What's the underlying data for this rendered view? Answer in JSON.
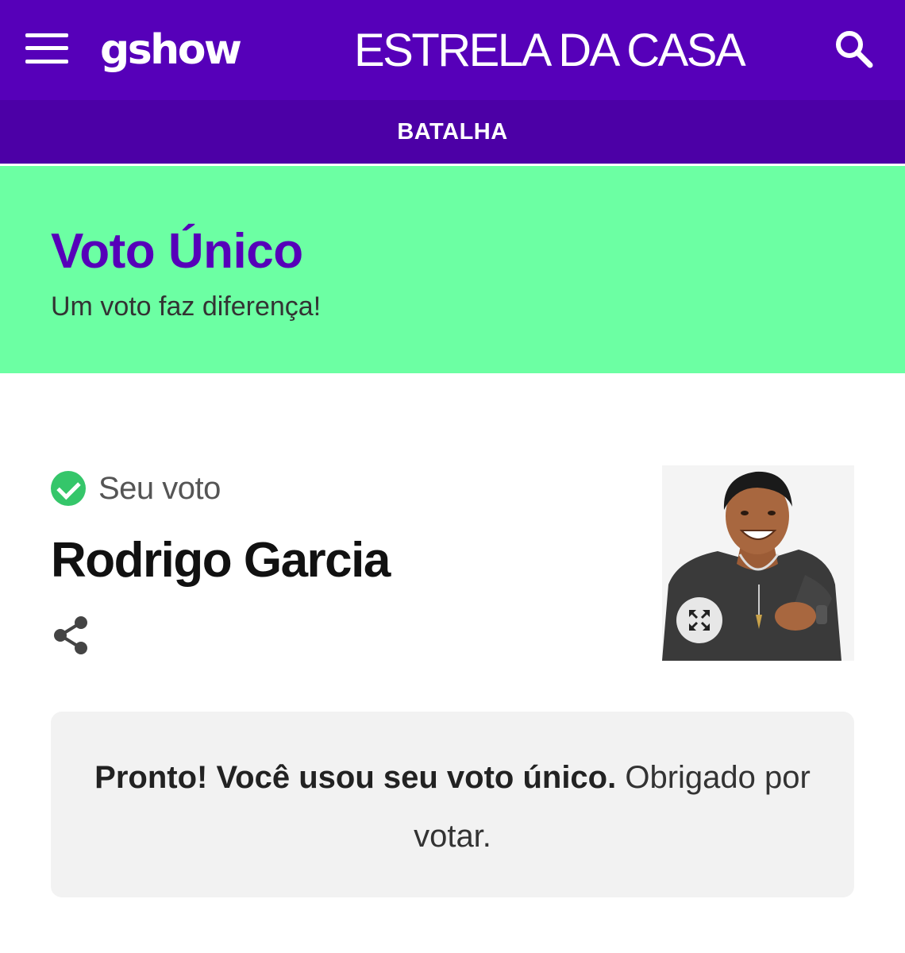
{
  "header": {
    "logo_text": "gshow",
    "title": "ESTRELA DA CASA",
    "menu_icon": "hamburger-menu-icon",
    "search_icon": "search-icon",
    "background_color": "#5600b9"
  },
  "subnav": {
    "label": "BATALHA",
    "background_color": "#4c00a6"
  },
  "hero": {
    "title": "Voto Único",
    "subtitle": "Um voto faz diferença!",
    "background_color": "#6cffa3",
    "title_color": "#5600b9"
  },
  "vote": {
    "label": "Seu voto",
    "status_icon": "check-circle-icon",
    "candidate": "Rodrigo Garcia",
    "share_icon": "share-icon",
    "expand_icon": "expand-icon"
  },
  "notice": {
    "bold_text": "Pronto! Você usou seu voto único.",
    "text": "Obrigado por votar."
  }
}
